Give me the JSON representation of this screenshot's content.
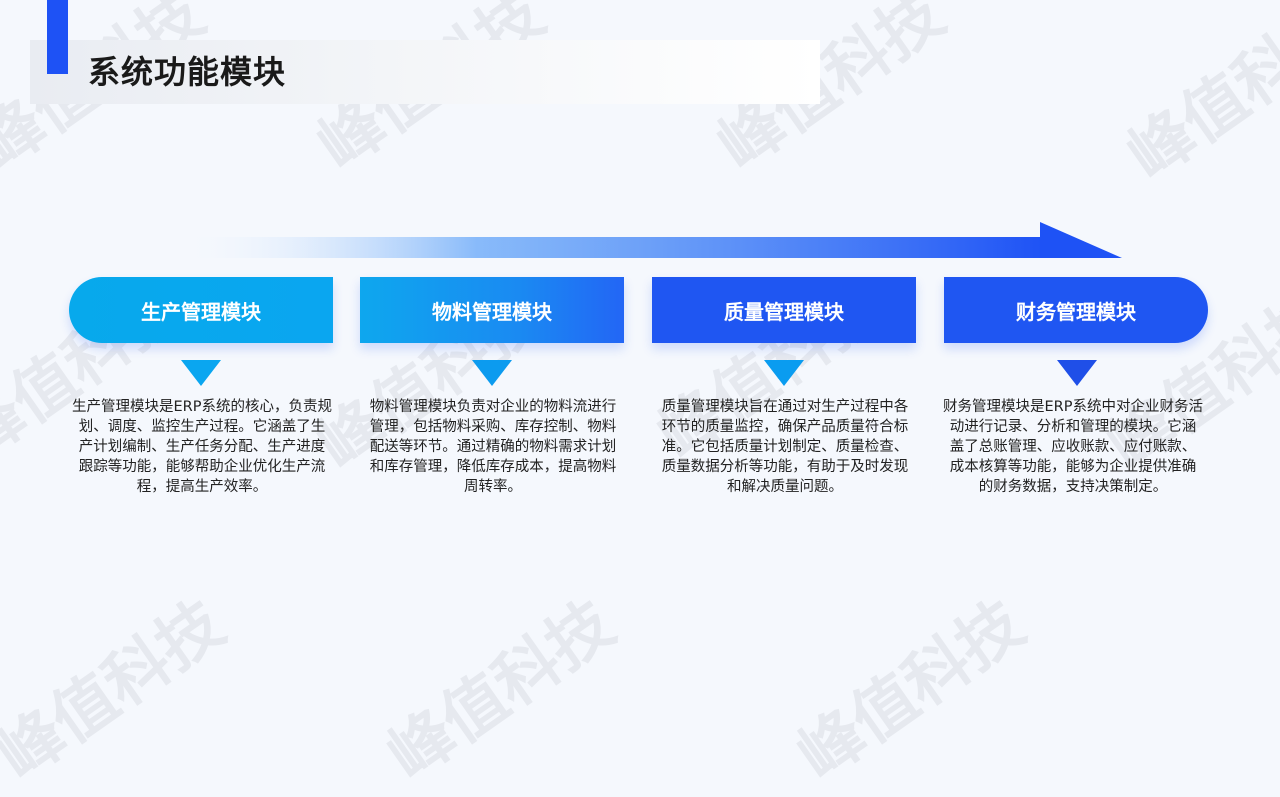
{
  "page_title": "系统功能模块",
  "watermark": "峰值科技",
  "modules": [
    {
      "label": "生产管理模块",
      "description": "生产管理模块是ERP系统的核心，负责规划、调度、监控生产过程。它涵盖了生产计划编制、生产任务分配、生产进度跟踪等功能，能够帮助企业优化生产流程，提高生产效率。"
    },
    {
      "label": "物料管理模块",
      "description": "物料管理模块负责对企业的物料流进行管理，包括物料采购、库存控制、物料配送等环节。通过精确的物料需求计划和库存管理，降低库存成本，提高物料周转率。"
    },
    {
      "label": "质量管理模块",
      "description": "质量管理模块旨在通过对生产过程中各环节的质量监控，确保产品质量符合标准。它包括质量计划制定、质量检查、质量数据分析等功能，有助于及时发现和解决质量问题。"
    },
    {
      "label": "财务管理模块",
      "description": "财务管理模块是ERP系统中对企业财务活动进行记录、分析和管理的模块。它涵盖了总账管理、应收账款、应付账款、成本核算等功能，能够为企业提供准确的财务数据，支持决策制定。"
    }
  ],
  "colors": {
    "accent": "#1e52f5",
    "cyan": "#0aa6f0",
    "blue": "#1f56f2"
  }
}
